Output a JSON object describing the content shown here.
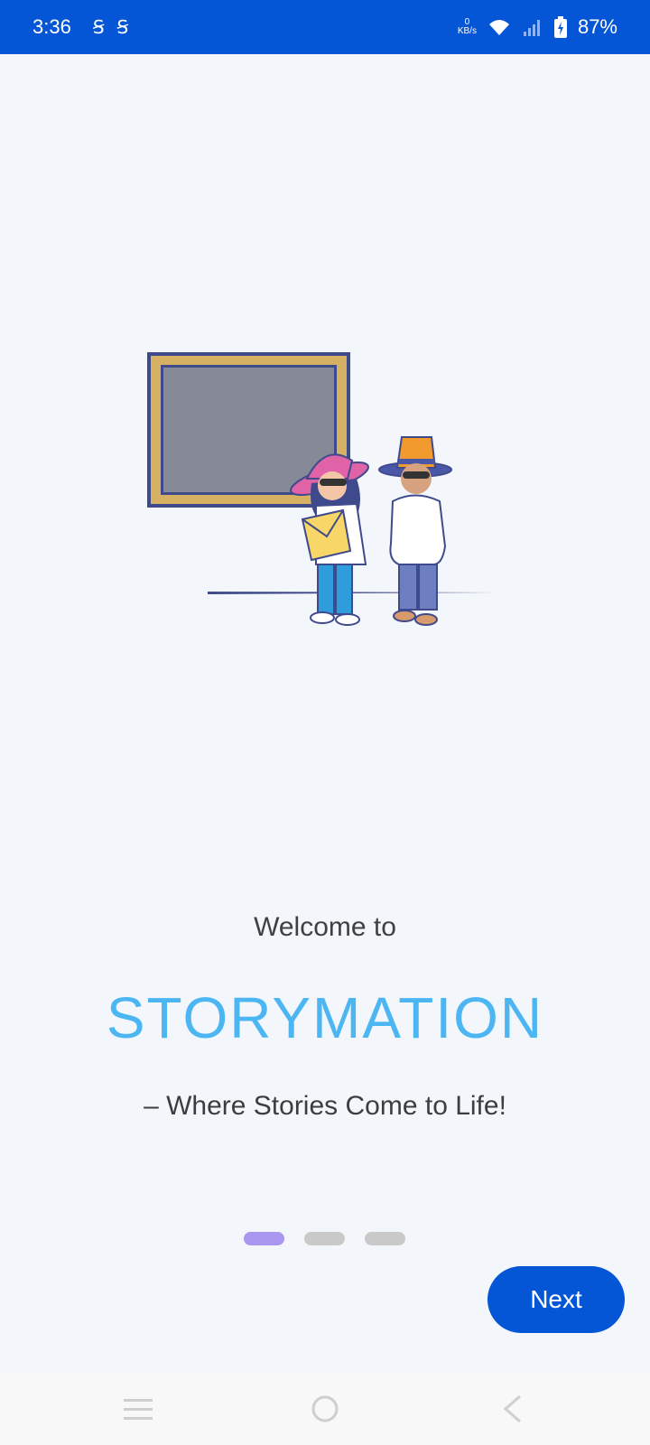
{
  "status_bar": {
    "time": "3:36",
    "sim_icons": [
      "sim-s-icon",
      "sim-s-icon"
    ],
    "net_speed_value": "0",
    "net_speed_unit": "KB/s",
    "battery": "87%"
  },
  "onboarding": {
    "welcome": "Welcome to",
    "brand": "STORYMATION",
    "tagline": "– Where Stories Come to Life!",
    "pages_total": 3,
    "current_page": 1
  },
  "actions": {
    "next_label": "Next"
  },
  "colors": {
    "status_bar_bg": "#0556d6",
    "brand_text": "#4cb6f2",
    "dot_active": "#a996ee",
    "dot_inactive": "#c9c9c9",
    "button_bg": "#0556d6"
  }
}
